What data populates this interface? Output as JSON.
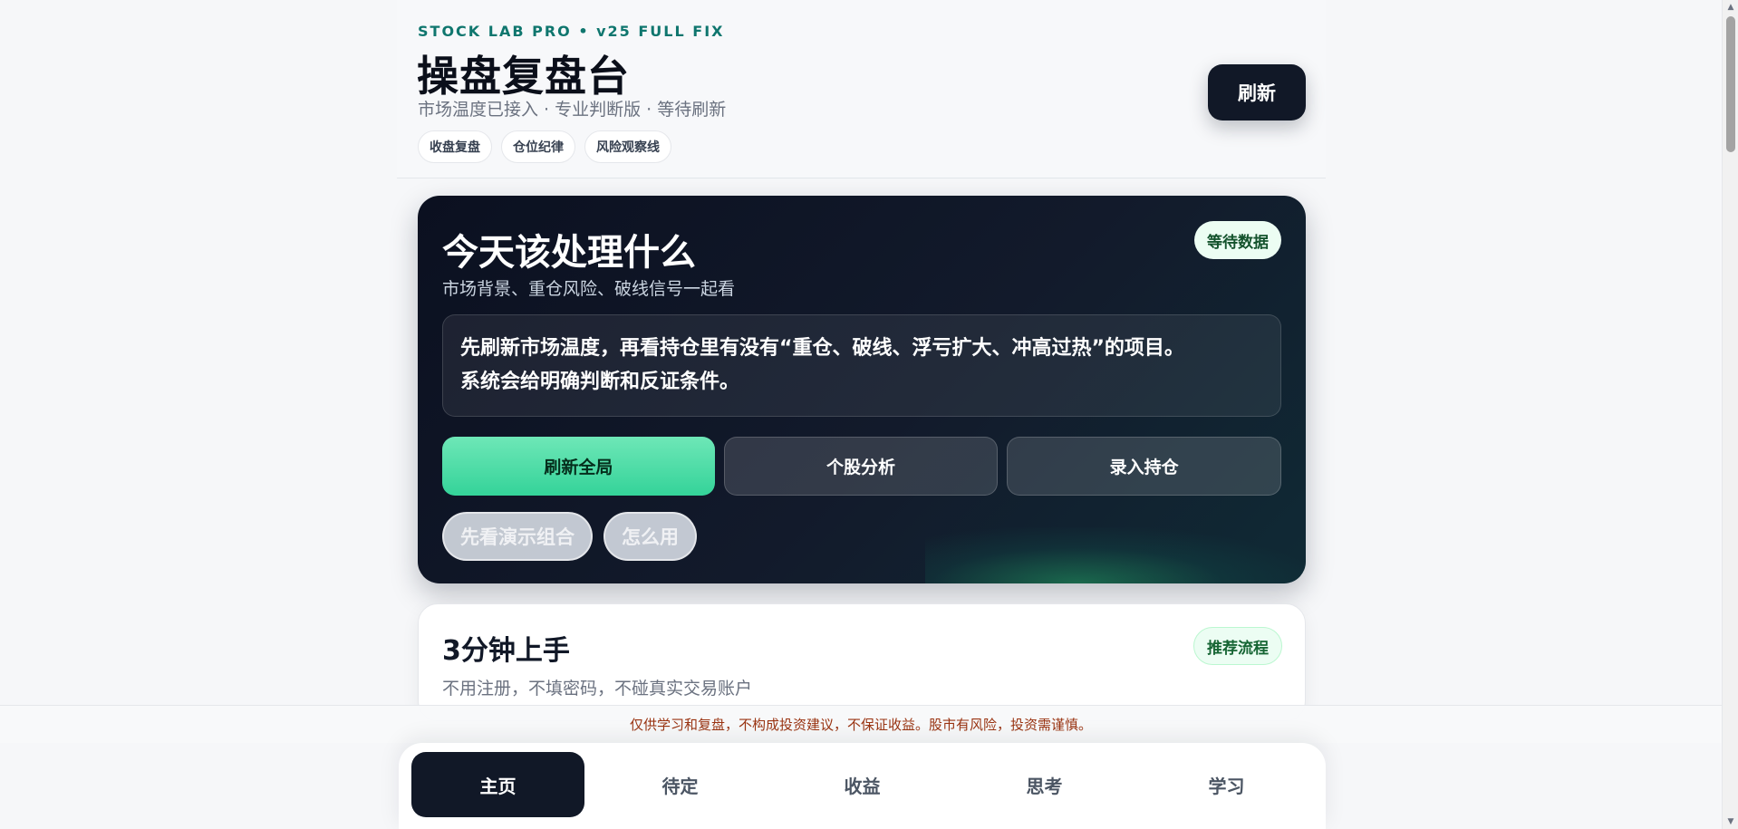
{
  "header": {
    "eyebrow": "STOCK LAB PRO • v25 FULL FIX",
    "title": "操盘复盘台",
    "subtitle": "市场温度已接入 · 专业判断版 · 等待刷新",
    "tags": [
      "收盘复盘",
      "仓位纪律",
      "风险观察线"
    ],
    "refresh_label": "刷新"
  },
  "hero": {
    "title": "今天该处理什么",
    "subtitle": "市场背景、重仓风险、破线信号一起看",
    "badge": "等待数据",
    "message_line1": "先刷新市场温度，再看持仓里有没有“重仓、破线、浮亏扩大、冲高过热”的项目。",
    "message_line2": "系统会给明确判断和反证条件。",
    "actions": [
      "刷新全局",
      "个股分析",
      "录入持仓"
    ],
    "pills": [
      "先看演示组合",
      "怎么用"
    ]
  },
  "quickstart": {
    "title": "3分钟上手",
    "subtitle": "不用注册，不填密码，不碰真实交易账户",
    "badge": "推荐流程"
  },
  "disclaimer": "仅供学习和复盘，不构成投资建议，不保证收益。股市有风险，投资需谨慎。",
  "nav": {
    "items": [
      "主页",
      "待定",
      "收益",
      "思考",
      "学习"
    ],
    "active": "主页"
  }
}
